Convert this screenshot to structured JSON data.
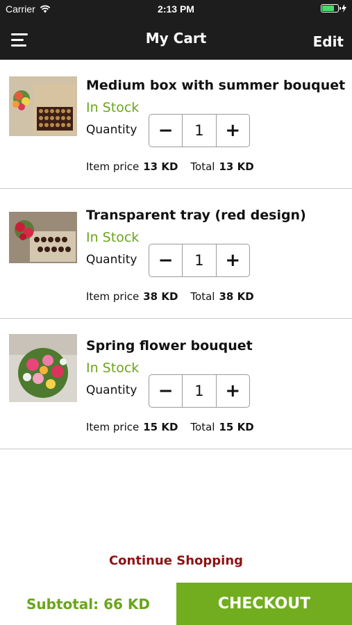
{
  "status_bar": {
    "carrier": "Carrier",
    "time": "2:13 PM",
    "battery_level": 0.8
  },
  "header": {
    "title": "My Cart",
    "edit_label": "Edit"
  },
  "labels": {
    "quantity": "Quantity",
    "item_price": "Item price",
    "total": "Total",
    "minus": "−",
    "plus": "+"
  },
  "items": [
    {
      "name": "Medium box with summer bouquet",
      "stock": "In Stock",
      "quantity": "1",
      "item_price": "13 KD",
      "total": "13 KD"
    },
    {
      "name": "Transparent tray (red design)",
      "stock": "In Stock",
      "quantity": "1",
      "item_price": "38 KD",
      "total": "38 KD"
    },
    {
      "name": "Spring flower bouquet",
      "stock": "In Stock",
      "quantity": "1",
      "item_price": "15 KD",
      "total": "15 KD"
    }
  ],
  "footer": {
    "continue_label": "Continue Shopping",
    "subtotal": "Subtotal: 66 KD",
    "checkout_label": "CHECKOUT"
  },
  "colors": {
    "accent_green": "#72ad1f",
    "stock_green": "#6aa51a",
    "continue_red": "#8b1414",
    "bar_dark": "#1d1d1d"
  }
}
